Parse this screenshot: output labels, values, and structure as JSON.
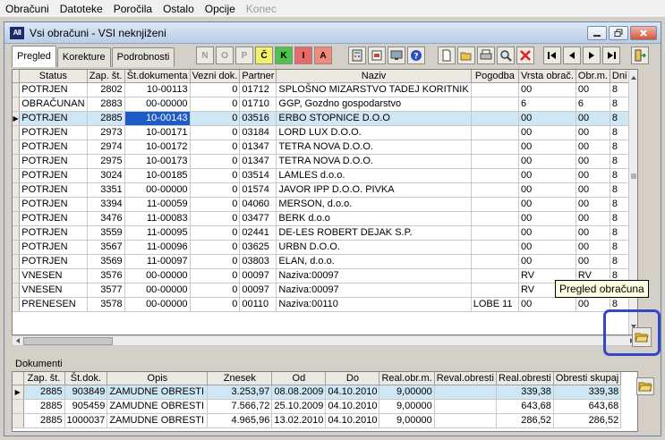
{
  "menu": [
    "Obračuni",
    "Datoteke",
    "Poročila",
    "Ostalo",
    "Opcije",
    "Konec"
  ],
  "window": {
    "icon_text": "AII",
    "title": "Vsi obračuni - VSI neknjiženi"
  },
  "tabs": [
    "Pregled",
    "Korekture",
    "Podrobnosti"
  ],
  "filter_buttons": [
    "N",
    "O",
    "P",
    "Č",
    "K",
    "I",
    "A"
  ],
  "grid": {
    "columns": [
      "Status",
      "Zap. št.",
      "Št.dokumenta",
      "Vezni dok.",
      "Partner",
      "Naziv",
      "Pogodba",
      "Vrsta obrač.",
      "Obr.m.",
      "Dni z"
    ],
    "rows": [
      [
        "POTRJEN",
        "2802",
        "10-00113",
        "0",
        "01712",
        "SPLOŠNO MIZARSTVO TADEJ KORITNIK",
        "",
        "00",
        "00",
        "8"
      ],
      [
        "OBRAČUNAN",
        "2883",
        "00-00000",
        "0",
        "01710",
        "GGP, Gozdno gospodarstvo",
        "",
        "6",
        "6",
        "8"
      ],
      [
        "POTRJEN",
        "2885",
        "10-00143",
        "0",
        "03516",
        "ERBO STOPNICE D.O.O",
        "",
        "00",
        "00",
        "8"
      ],
      [
        "POTRJEN",
        "2973",
        "10-00171",
        "0",
        "03184",
        "LORD LUX D.O.O.",
        "",
        "00",
        "00",
        "8"
      ],
      [
        "POTRJEN",
        "2974",
        "10-00172",
        "0",
        "01347",
        "TETRA NOVA D.O.O.",
        "",
        "00",
        "00",
        "8"
      ],
      [
        "POTRJEN",
        "2975",
        "10-00173",
        "0",
        "01347",
        "TETRA NOVA D.O.O.",
        "",
        "00",
        "00",
        "8"
      ],
      [
        "POTRJEN",
        "3024",
        "10-00185",
        "0",
        "03514",
        "LAMLES d.o.o.",
        "",
        "00",
        "00",
        "8"
      ],
      [
        "POTRJEN",
        "3351",
        "00-00000",
        "0",
        "01574",
        "JAVOR IPP  D.O.O. PIVKA",
        "",
        "00",
        "00",
        "8"
      ],
      [
        "POTRJEN",
        "3394",
        "11-00059",
        "0",
        "04060",
        "MERSON, d.o.o.",
        "",
        "00",
        "00",
        "8"
      ],
      [
        "POTRJEN",
        "3476",
        "11-00083",
        "0",
        "03477",
        "BERK d.o.o",
        "",
        "00",
        "00",
        "8"
      ],
      [
        "POTRJEN",
        "3559",
        "11-00095",
        "0",
        "02441",
        "DE-LES ROBERT DEJAK S.P.",
        "",
        "00",
        "00",
        "8"
      ],
      [
        "POTRJEN",
        "3567",
        "11-00096",
        "0",
        "03625",
        "URBN D.O.O.",
        "",
        "00",
        "00",
        "8"
      ],
      [
        "POTRJEN",
        "3569",
        "11-00097",
        "0",
        "03803",
        "ELAN, d.o.o.",
        "",
        "00",
        "00",
        "8"
      ],
      [
        "VNESEN",
        "3576",
        "00-00000",
        "0",
        "00097",
        "Naziva:00097",
        "",
        "RV",
        "RV",
        "8"
      ],
      [
        "VNESEN",
        "3577",
        "00-00000",
        "0",
        "00097",
        "Naziva:00097",
        "",
        "RV",
        "",
        ""
      ],
      [
        "PRENESEN",
        "3578",
        "00-00000",
        "0",
        "00110",
        "Naziva:00110",
        "LOBE 11",
        "00",
        "00",
        "8"
      ]
    ]
  },
  "tooltip": "Pregled obračuna",
  "dokumenti": {
    "label": "Dokumenti",
    "columns": [
      "Zap. št.",
      "Št.dok.",
      "Opis",
      "Znesek",
      "Od",
      "Do",
      "Real.obr.m.",
      "Reval.obresti",
      "Real.obresti",
      "Obresti skupaj"
    ],
    "rows": [
      [
        "2885",
        "903849",
        "ZAMUDNE OBRESTI",
        "3.253,97",
        "08.08.2009",
        "04.10.2010",
        "9,00000",
        "",
        "339,38",
        "339,38"
      ],
      [
        "2885",
        "905459",
        "ZAMUDNE OBRESTI",
        "7.566,72",
        "25.10.2009",
        "04.10.2010",
        "9,00000",
        "",
        "643,68",
        "643,68"
      ],
      [
        "2885",
        "1000037",
        "ZAMUDNE OBRESTI",
        "4.965,96",
        "13.02.2010",
        "04.10.2010",
        "9,00000",
        "",
        "286,52",
        "286,52"
      ]
    ]
  }
}
